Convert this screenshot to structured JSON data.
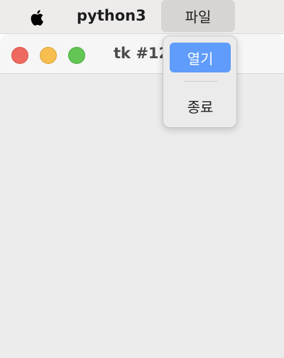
{
  "menubar": {
    "apple_icon": "apple-logo-icon",
    "app_name": "python3",
    "file_menu_label": "파일"
  },
  "window": {
    "title": "tk #12",
    "buttons": {
      "close_color": "#ee6a5f",
      "minimize_color": "#f5be4f",
      "maximize_color": "#62c554"
    }
  },
  "file_menu": {
    "open_label": "열기",
    "quit_label": "종료",
    "highlight_color": "#5f9cfb"
  }
}
